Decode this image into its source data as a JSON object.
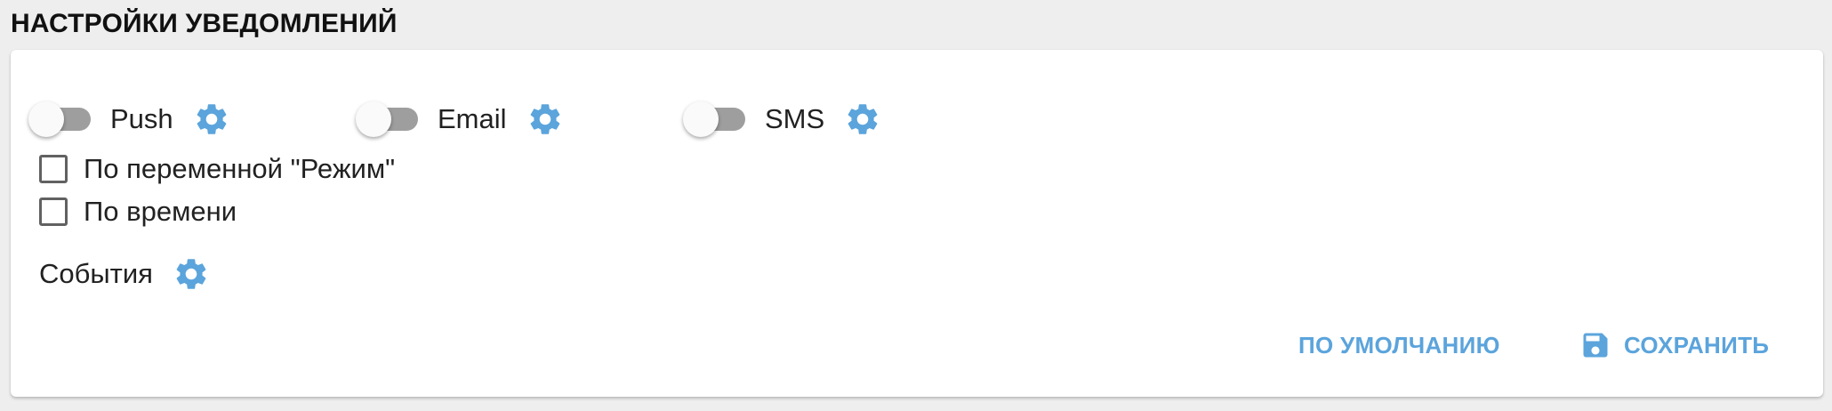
{
  "page": {
    "title": "НАСТРОЙКИ УВЕДОМЛЕНИЙ"
  },
  "channels": [
    {
      "label": "Push",
      "enabled": false,
      "settings_icon": "gear-icon"
    },
    {
      "label": "Email",
      "enabled": false,
      "settings_icon": "gear-icon"
    },
    {
      "label": "SMS",
      "enabled": false,
      "settings_icon": "gear-icon"
    }
  ],
  "options": [
    {
      "label": "По переменной \"Режим\"",
      "checked": false
    },
    {
      "label": "По времени",
      "checked": false
    }
  ],
  "events": {
    "label": "События",
    "settings_icon": "gear-icon"
  },
  "actions": {
    "default_label": "ПО УМОЛЧАНИЮ",
    "save_label": "СОХРАНИТЬ",
    "save_icon": "floppy-disk-icon"
  },
  "colors": {
    "accent": "#5ba4dc",
    "toggle_off_track": "#9e9e9e",
    "toggle_off_thumb": "#fafafa",
    "page_background": "#eeeeee",
    "card_background": "#ffffff"
  }
}
